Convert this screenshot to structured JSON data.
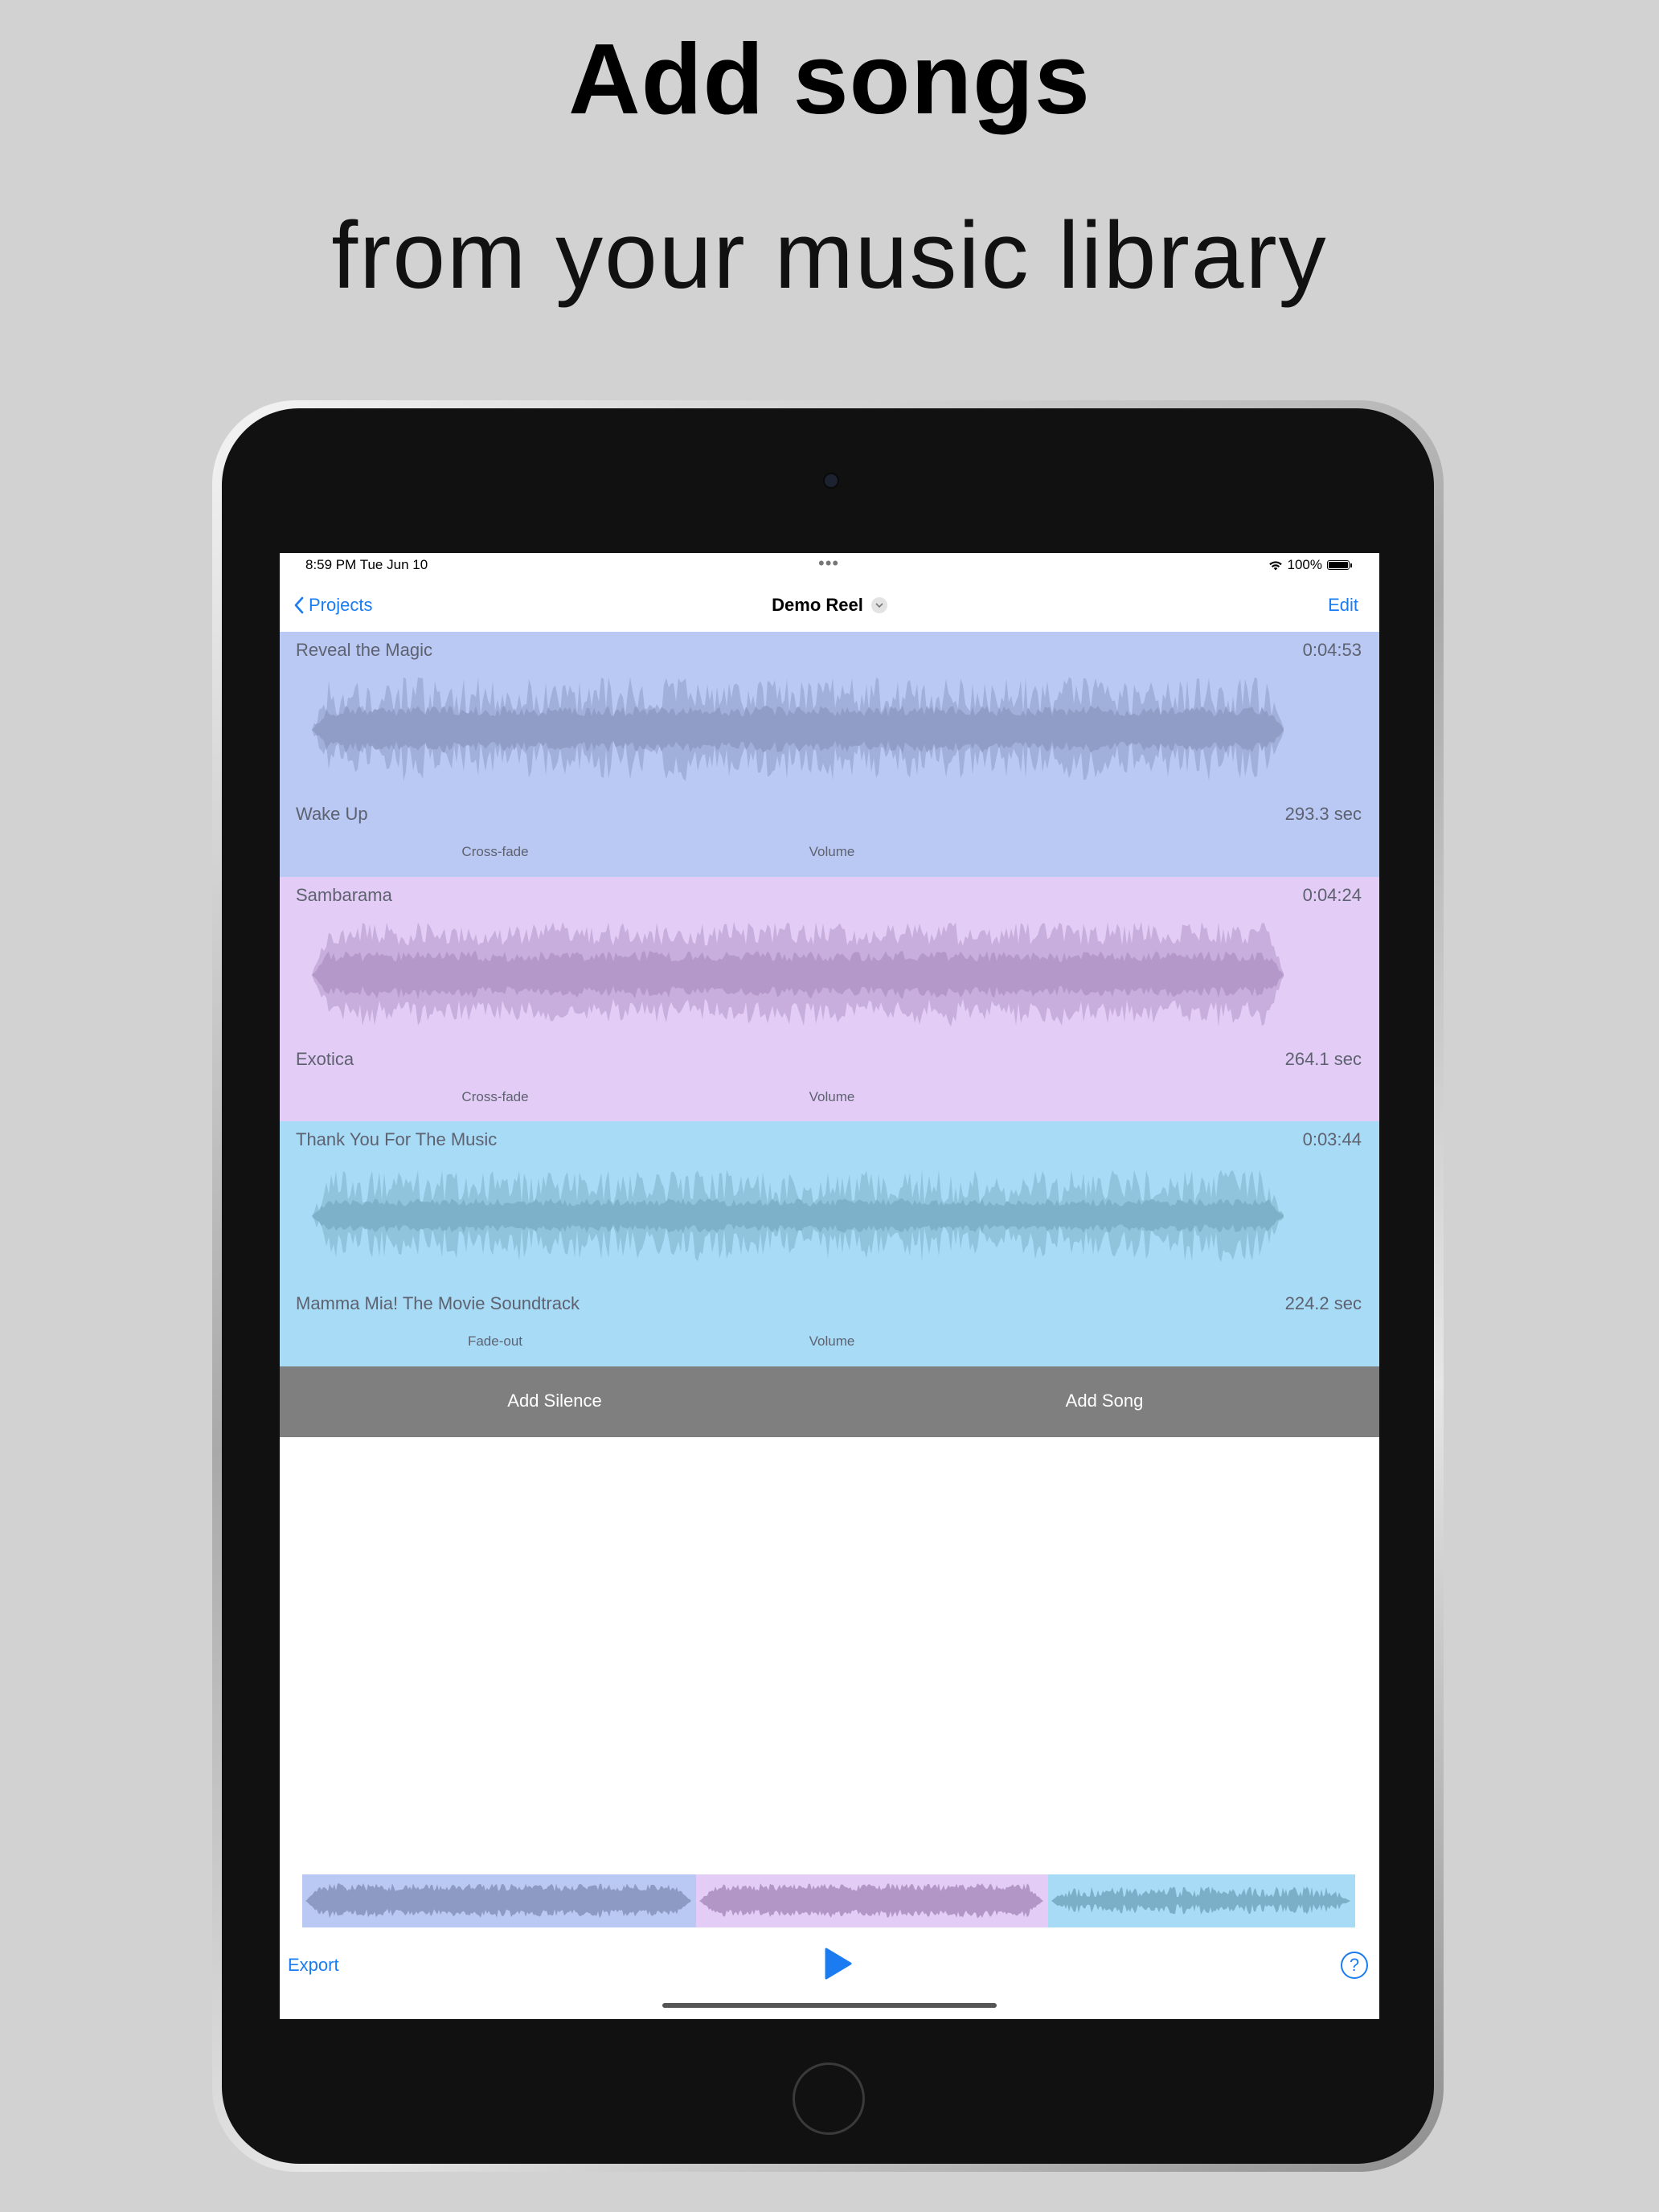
{
  "headline": "Add songs",
  "subheadline": "from your music library",
  "status_bar": {
    "time": "8:59 PM   Tue Jun 10",
    "dots": "•••",
    "battery": "100%"
  },
  "nav": {
    "back_label": "Projects",
    "title": "Demo Reel",
    "edit_label": "Edit"
  },
  "tracks": [
    {
      "title": "Reveal the Magic",
      "duration": "0:04:53",
      "album": "Wake Up",
      "length": "293.3 sec",
      "transition": "Cross-fade",
      "volume_label": "Volume",
      "bg": "#bac9f3",
      "wave": "#8d9bc4"
    },
    {
      "title": "Sambarama",
      "duration": "0:04:24",
      "album": "Exotica",
      "length": "264.1 sec",
      "transition": "Cross-fade",
      "volume_label": "Volume",
      "bg": "#e3ccf5",
      "wave": "#b196c6"
    },
    {
      "title": "Thank You For The Music",
      "duration": "0:03:44",
      "album": "Mamma Mia! The Movie Soundtrack",
      "length": "224.2 sec",
      "transition": "Fade-out",
      "volume_label": "Volume",
      "bg": "#a8dbf6",
      "wave": "#7bafc7"
    }
  ],
  "actions": {
    "add_silence": "Add Silence",
    "add_song": "Add Song"
  },
  "toolbar": {
    "export_label": "Export",
    "help_label": "?"
  },
  "colors": {
    "accent": "#1a7cf0",
    "action_bar": "#7f7f7f"
  }
}
